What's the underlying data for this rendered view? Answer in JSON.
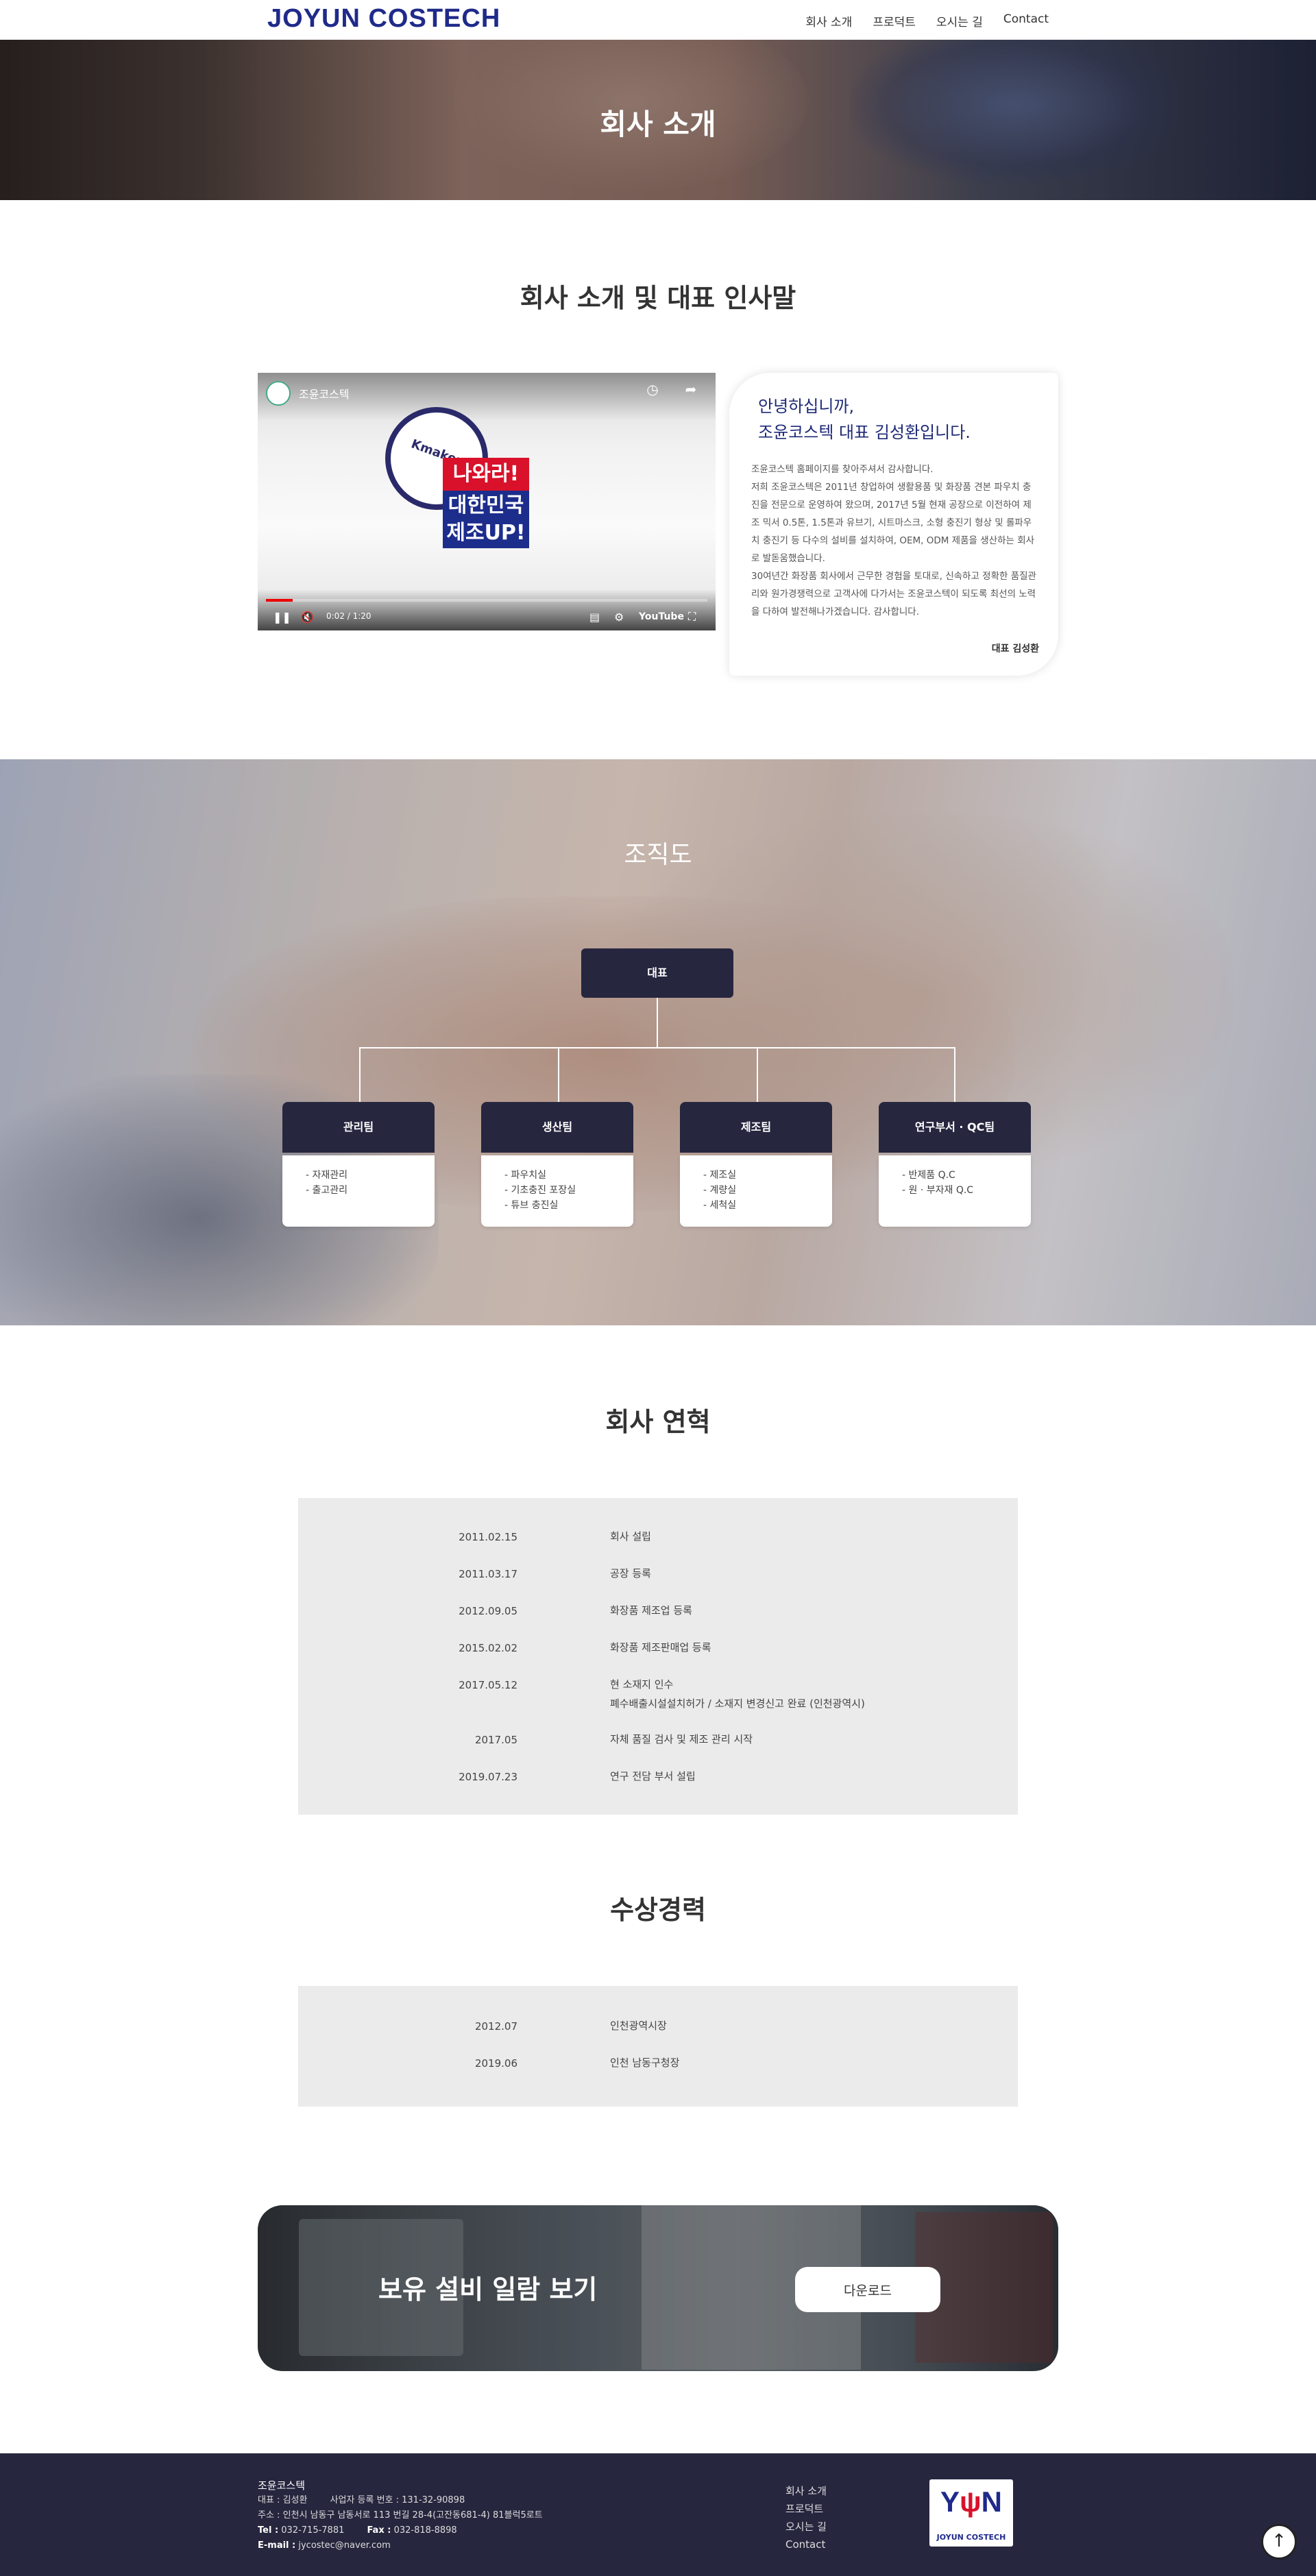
{
  "header": {
    "logo": "JOYUN COSTECH",
    "nav": [
      "회사 소개",
      "프로덕트",
      "오시는 길",
      "Contact"
    ]
  },
  "hero": {
    "title": "회사 소개"
  },
  "intro": {
    "section_title": "회사 소개 및 대표 인사말",
    "video": {
      "channel": "조윤코스텍",
      "badge_red": "나와라!",
      "badge_blue_1": "대한민국",
      "badge_blue_2": "제조UP!",
      "time": "0:02 / 1:20",
      "youtube": "YouTube"
    },
    "greeting": {
      "heading_1": "안녕하십니까,",
      "heading_2": "조윤코스텍 대표 김성환입니다.",
      "p1": "조윤코스텍 홈페이지를 찾아주셔서 감사합니다.",
      "p2": "저희 조윤코스텍은 2011년 창업하여 생활용품 및 화장품 견본 파우치 충진을 전문으로 운영하여 왔으며, 2017년 5월 현재 공장으로 이전하여 제조 믹서 0.5톤, 1.5톤과 유브기, 시트마스크, 소형 충진기 형상 및 롤파우치 충진기 등 다수의 설비를 설치하여, OEM, ODM 제품을 생산하는 회사로 발돋움했습니다.",
      "p3": "30여년간 화장품 회사에서 근무한 경험을 토대로, 신속하고 정확한 품질관리와 원가경쟁력으로 고객사에 다가서는 조윤코스텍이 되도록 최선의 노력을 다하여 발전해나가겠습니다. 감사합니다.",
      "signature": "대표 김성환"
    }
  },
  "org": {
    "title": "조직도",
    "ceo": "대표",
    "teams": [
      {
        "name": "관리팀",
        "items": [
          "- 자재관리",
          "- 출고관리"
        ]
      },
      {
        "name": "생산팀",
        "items": [
          "- 파우치실",
          "- 기초충진 포장실",
          "- 튜브 충진실"
        ]
      },
      {
        "name": "제조팀",
        "items": [
          "- 제조실",
          "- 계량실",
          "- 세척실"
        ]
      },
      {
        "name": "연구부서 · QC팀",
        "items": [
          "- 반제품 Q.C",
          "- 원 · 부자재 Q.C"
        ]
      }
    ]
  },
  "history": {
    "title": "회사 연혁",
    "rows": [
      {
        "date": "2011.02.15",
        "text": "회사 설립"
      },
      {
        "date": "2011.03.17",
        "text": "공장 등록"
      },
      {
        "date": "2012.09.05",
        "text": "화장품 제조업 등록"
      },
      {
        "date": "2015.02.02",
        "text": "화장품 제조판매업 등록"
      },
      {
        "date": "2017.05.12",
        "text": "현 소재지 인수",
        "text2": "폐수배출시설설치허가 / 소재지 변경신고 완료 (인천광역시)"
      },
      {
        "date": "2017.05",
        "text": "자체 품질 검사 및 제조 관리 시작"
      },
      {
        "date": "2019.07.23",
        "text": "연구 전담 부서 설립"
      }
    ]
  },
  "awards": {
    "title": "수상경력",
    "rows": [
      {
        "date": "2012.07",
        "text": "인천광역시장"
      },
      {
        "date": "2019.06",
        "text": "인천 남동구청장"
      }
    ]
  },
  "banner": {
    "title": "보유 설비 일람 보기",
    "button": "다운로드"
  },
  "footer": {
    "company": "조윤코스텍",
    "line1": "대표 : 김성환        사업자 등록 번호 : 131-32-90898",
    "line2": "주소 : 인천시 남동구 남동서로 113 번길 28-4(고잔동681-4) 81블럭5로트",
    "tel_label": "Tel :",
    "tel": "032-715-7881",
    "fax_label": "Fax :",
    "fax": "032-818-8898",
    "email_label": "E-mail :",
    "email": "jycostec@naver.com",
    "nav": [
      "회사 소개",
      "프로덕트",
      "오시는 길",
      "Contact"
    ],
    "logo_mark_a": "Y",
    "logo_mark_b": "N",
    "logo_word": "JOYUN COSTECH"
  }
}
